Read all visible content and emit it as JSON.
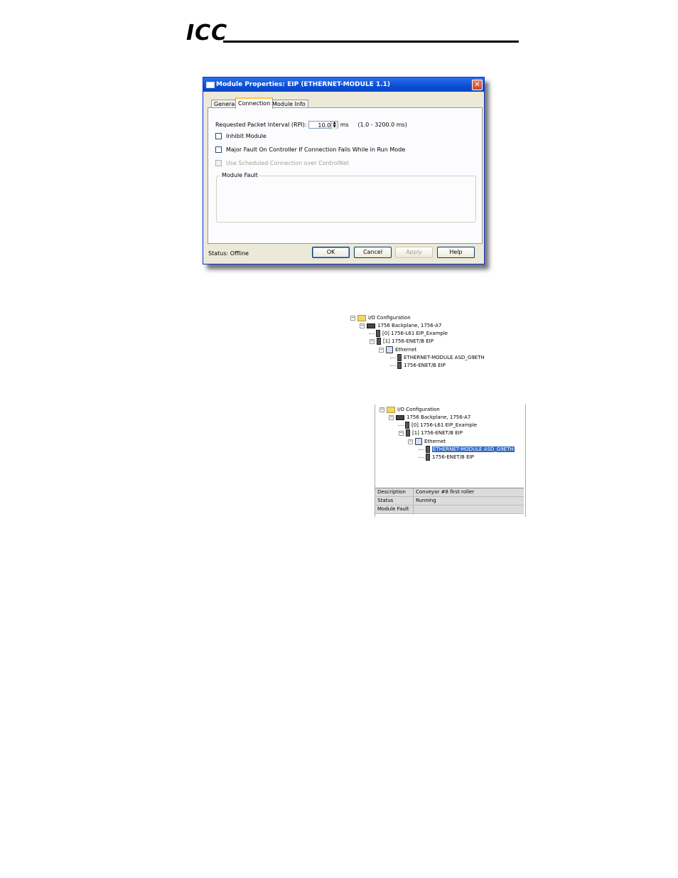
{
  "header": {
    "logo_text": "ICC"
  },
  "dialog": {
    "title": "Module Properties: EIP (ETHERNET-MODULE 1.1)",
    "close_glyph": "✕",
    "tabs": [
      {
        "label": "General"
      },
      {
        "label": "Connection",
        "active": true
      },
      {
        "label": "Module Info"
      }
    ],
    "rpi": {
      "label": "Requested Packet Interval (RPI):",
      "value": "10.0",
      "unit": "ms",
      "range": "(1.0 - 3200.0 ms)"
    },
    "checkboxes": [
      {
        "label": "Inhibit Module",
        "checked": false,
        "enabled": true
      },
      {
        "label": "Major Fault On Controller If Connection Fails While in Run Mode",
        "checked": false,
        "enabled": true
      },
      {
        "label": "Use Scheduled Connection over ControlNet",
        "checked": false,
        "enabled": false
      }
    ],
    "module_fault_label": "Module Fault",
    "status": "Status:  Offline",
    "buttons": {
      "ok": "OK",
      "cancel": "Cancel",
      "apply": "Apply",
      "help": "Help"
    }
  },
  "tree1": {
    "nodes": [
      {
        "label": "I/O Configuration"
      },
      {
        "label": "1756 Backplane, 1756-A7"
      },
      {
        "label": "[0] 1756-L61 EIP_Example"
      },
      {
        "label": "[1] 1756-ENET/B EIP"
      },
      {
        "label": "Ethernet"
      },
      {
        "label": "ETHERNET-MODULE ASD_G9ETH"
      },
      {
        "label": "1756-ENET/B EIP"
      }
    ]
  },
  "tree2": {
    "nodes": [
      {
        "label": "I/O Configuration"
      },
      {
        "label": "1756 Backplane, 1756-A7"
      },
      {
        "label": "[0] 1756-L61 EIP_Example"
      },
      {
        "label": "[1] 1756-ENET/B EIP"
      },
      {
        "label": "Ethernet"
      },
      {
        "label": "ETHERNET-MODULE ASD_G9ETH",
        "selected": true
      },
      {
        "label": "1756-ENET/B EIP"
      }
    ],
    "properties": [
      {
        "key": "Description",
        "value": "Conveyor #8 first roller"
      },
      {
        "key": "Status",
        "value": "Running"
      },
      {
        "key": "Module Fault",
        "value": ""
      }
    ]
  },
  "icons": {
    "toggle_minus": "−",
    "spin_up": "▲",
    "spin_down": "▼"
  }
}
